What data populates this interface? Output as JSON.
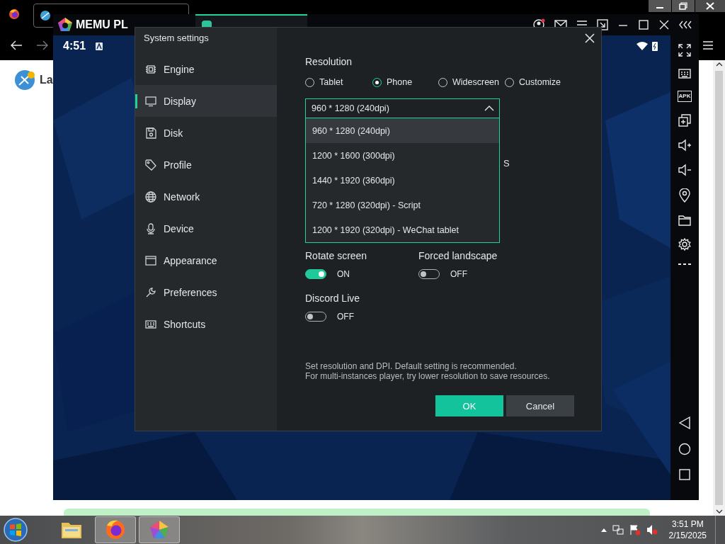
{
  "browser": {
    "page_text": "La"
  },
  "emulator": {
    "logo_text": "MEMU PL",
    "status_time": "4:51",
    "apk_label": "APK"
  },
  "dialog": {
    "title": "System settings",
    "nav": [
      {
        "label": "Engine",
        "selected": false
      },
      {
        "label": "Display",
        "selected": true
      },
      {
        "label": "Disk",
        "selected": false
      },
      {
        "label": "Profile",
        "selected": false
      },
      {
        "label": "Network",
        "selected": false
      },
      {
        "label": "Device",
        "selected": false
      },
      {
        "label": "Appearance",
        "selected": false
      },
      {
        "label": "Preferences",
        "selected": false
      },
      {
        "label": "Shortcuts",
        "selected": false
      }
    ],
    "resolution": {
      "label": "Resolution",
      "options": [
        {
          "label": "Tablet",
          "selected": false
        },
        {
          "label": "Phone",
          "selected": true
        },
        {
          "label": "Widescreen",
          "selected": false
        },
        {
          "label": "Customize",
          "selected": false
        }
      ],
      "dropdown": {
        "value": "960 * 1280 (240dpi)",
        "expanded": true,
        "options": [
          {
            "label": "960 * 1280 (240dpi)",
            "selected": true
          },
          {
            "label": "1200 * 1600 (300dpi)",
            "selected": false
          },
          {
            "label": "1440 * 1920 (360dpi)",
            "selected": false
          },
          {
            "label": "720 * 1280 (320dpi) - Script",
            "selected": false
          },
          {
            "label": "1200 * 1920 (320dpi) - WeChat tablet",
            "selected": false
          }
        ]
      },
      "partial_text": "S"
    },
    "toggles": [
      {
        "label": "Rotate screen",
        "on": true,
        "state_text": "ON"
      },
      {
        "label": "Forced landscape",
        "on": false,
        "state_text": "OFF"
      },
      {
        "label": "Discord Live",
        "on": false,
        "state_text": "OFF"
      }
    ],
    "note": [
      "Set resolution and DPI. Default setting is recommended.",
      "For multi-instances player, try lower resolution to save resources."
    ],
    "buttons": [
      {
        "label": "OK",
        "kind": "primary"
      },
      {
        "label": "Cancel",
        "kind": "secondary"
      }
    ]
  },
  "taskbar": {
    "items": [
      {
        "selected": false
      },
      {
        "selected": true
      },
      {
        "selected": true
      }
    ],
    "time": "3:51 PM",
    "date": "2/15/2025"
  }
}
